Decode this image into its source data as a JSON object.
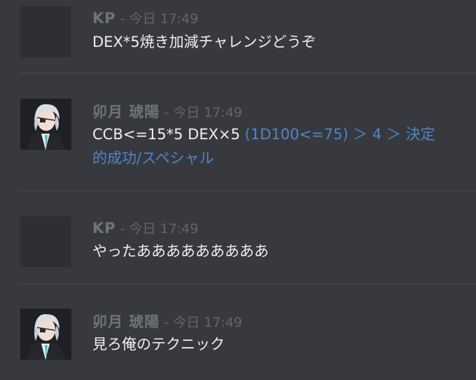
{
  "messages": [
    {
      "author": "KP",
      "meta": "- 今日 17:49",
      "avatar": "blank-avatar",
      "lines": [
        "DEX*5焼き加減チャレンジどうぞ"
      ]
    },
    {
      "author": "卯月 琥陽",
      "meta": "- 今日 17:49",
      "avatar": "character-avatar",
      "line1_plain": "CCB<=15*5 DEX×5 ",
      "line1_roll": "(1D100<=75) ＞ 4 ＞ 決定",
      "line2_roll": "的成功/スペシャル"
    },
    {
      "author": "KP",
      "meta": "- 今日 17:49",
      "avatar": "blank-avatar",
      "lines": [
        "やったあああああああああ"
      ]
    },
    {
      "author": "卯月 琥陽",
      "meta": "- 今日 17:49",
      "avatar": "character-avatar",
      "lines": [
        "見ろ俺のテクニック"
      ]
    }
  ],
  "colors": {
    "background": "#37393e",
    "name": "#6f7478",
    "roll_text": "#4f86c9"
  }
}
